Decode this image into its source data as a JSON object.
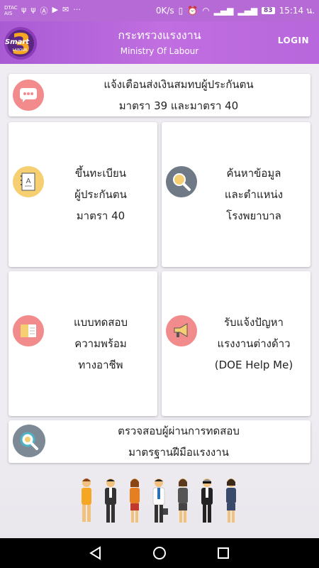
{
  "status_bar": {
    "carrier_line1": "DTAC",
    "carrier_line2": "AIS",
    "speed": "0K/s",
    "battery": "83",
    "time": "15:14 น."
  },
  "header": {
    "logo_text": "Smart",
    "logo_sub": "LABOUR",
    "logo_number": "3",
    "title_th": "กระทรวงแรงงาน",
    "title_en": "Ministry Of Labour",
    "login_label": "LOGIN"
  },
  "menu": {
    "contribution_alert": {
      "line1": "แจ้งเตือนส่งเงินสมทบผู้ประกันตน",
      "line2": "มาตรา 39 และมาตรา 40",
      "icon": "chat-bubble-icon"
    },
    "register": {
      "line1": "ขึ้นทะเบียน",
      "line2": "ผู้ประกันตน",
      "line3": "มาตรา 40",
      "icon": "notebook-icon"
    },
    "search_hospital": {
      "line1": "ค้นหาข้อมูล",
      "line2": "และตำแหน่ง",
      "line3": "โรงพยาบาล",
      "icon": "magnifier-icon"
    },
    "career_test": {
      "line1": "แบบทดสอบ",
      "line2": "ความพร้อม",
      "line3": "ทางอาชีพ",
      "icon": "open-book-icon"
    },
    "foreign_worker_help": {
      "line1": "รับแจ้งปัญหา",
      "line2": "แรงงานต่างด้าว",
      "line3": "(DOE Help Me)",
      "icon": "megaphone-icon"
    },
    "skill_standard_check": {
      "line1": "ตรวจสอบผู้ผ่านการทดสอบ",
      "line2": "มาตรฐานฝีมือแรงงาน",
      "icon": "search-check-icon"
    }
  },
  "colors": {
    "header_purple": "#b66ad6",
    "icon_pink": "#f28b8b",
    "icon_yellow": "#f5cf72",
    "icon_gray": "#6f7a86"
  }
}
